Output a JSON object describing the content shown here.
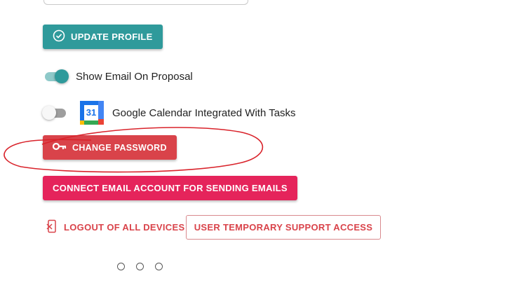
{
  "profile": {
    "update_label": "UPDATE PROFILE"
  },
  "toggles": [
    {
      "label": "Show Email On Proposal",
      "state": "on"
    },
    {
      "label": "Google Calendar Integrated With Tasks",
      "state": "off",
      "icon_text": "31"
    }
  ],
  "buttons": {
    "change_password": "CHANGE PASSWORD",
    "connect_email": "CONNECT EMAIL ACCOUNT FOR SENDING EMAILS",
    "logout_all": "LOGOUT OF ALL DEVICES",
    "temp_support": "USER TEMPORARY SUPPORT ACCESS"
  },
  "icons": {
    "update": "check-circle-icon",
    "password": "key-icon",
    "logout": "logout-icon",
    "calendar": "google-calendar-icon"
  },
  "colors": {
    "teal": "#2f9a9b",
    "red": "#d9434a",
    "pink": "#e5245b",
    "annotation": "#d9232b"
  },
  "pagination": {
    "dots": 3
  }
}
